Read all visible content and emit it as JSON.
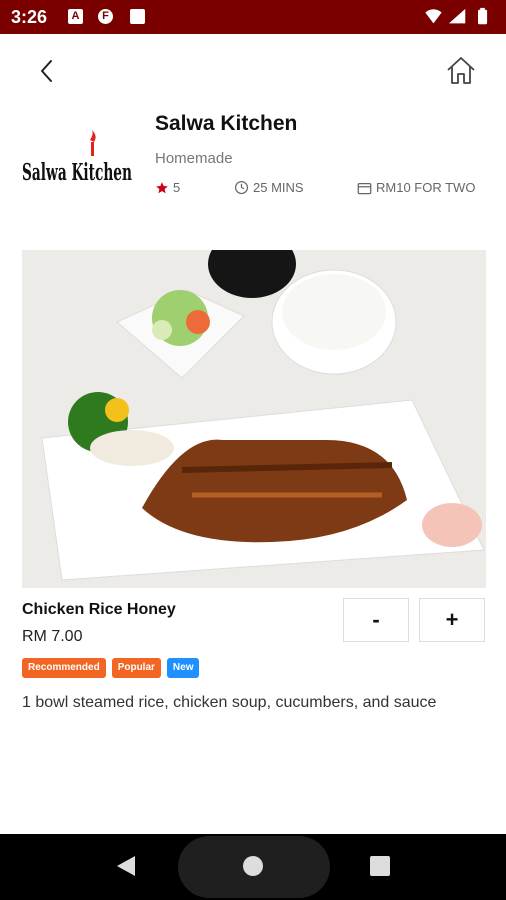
{
  "status_bar": {
    "time": "3:26",
    "icons": [
      "a-notification-icon",
      "f-notification-icon",
      "sd-card-icon",
      "wifi-icon",
      "signal-icon",
      "battery-icon"
    ]
  },
  "nav": {
    "back_icon": "back-icon",
    "home_icon": "home-icon"
  },
  "restaurant": {
    "logo_text": "Salwa Kitchen",
    "name": "Salwa Kitchen",
    "category": "Homemade",
    "rating": "5",
    "time": "25 MINS",
    "price_for_two": "RM10 FOR TWO"
  },
  "item": {
    "name": "Chicken Rice Honey",
    "price": "RM 7.00",
    "minus_label": "-",
    "plus_label": "+",
    "tags": [
      {
        "label": "Recommended",
        "color": "#f26522"
      },
      {
        "label": "Popular",
        "color": "#f26522"
      },
      {
        "label": "New",
        "color": "#1e90ff"
      }
    ],
    "description": "1 bowl steamed rice, chicken soup, cucumbers, and sauce"
  },
  "colors": {
    "status_bar": "#7a0000",
    "star": "#d0021b"
  }
}
